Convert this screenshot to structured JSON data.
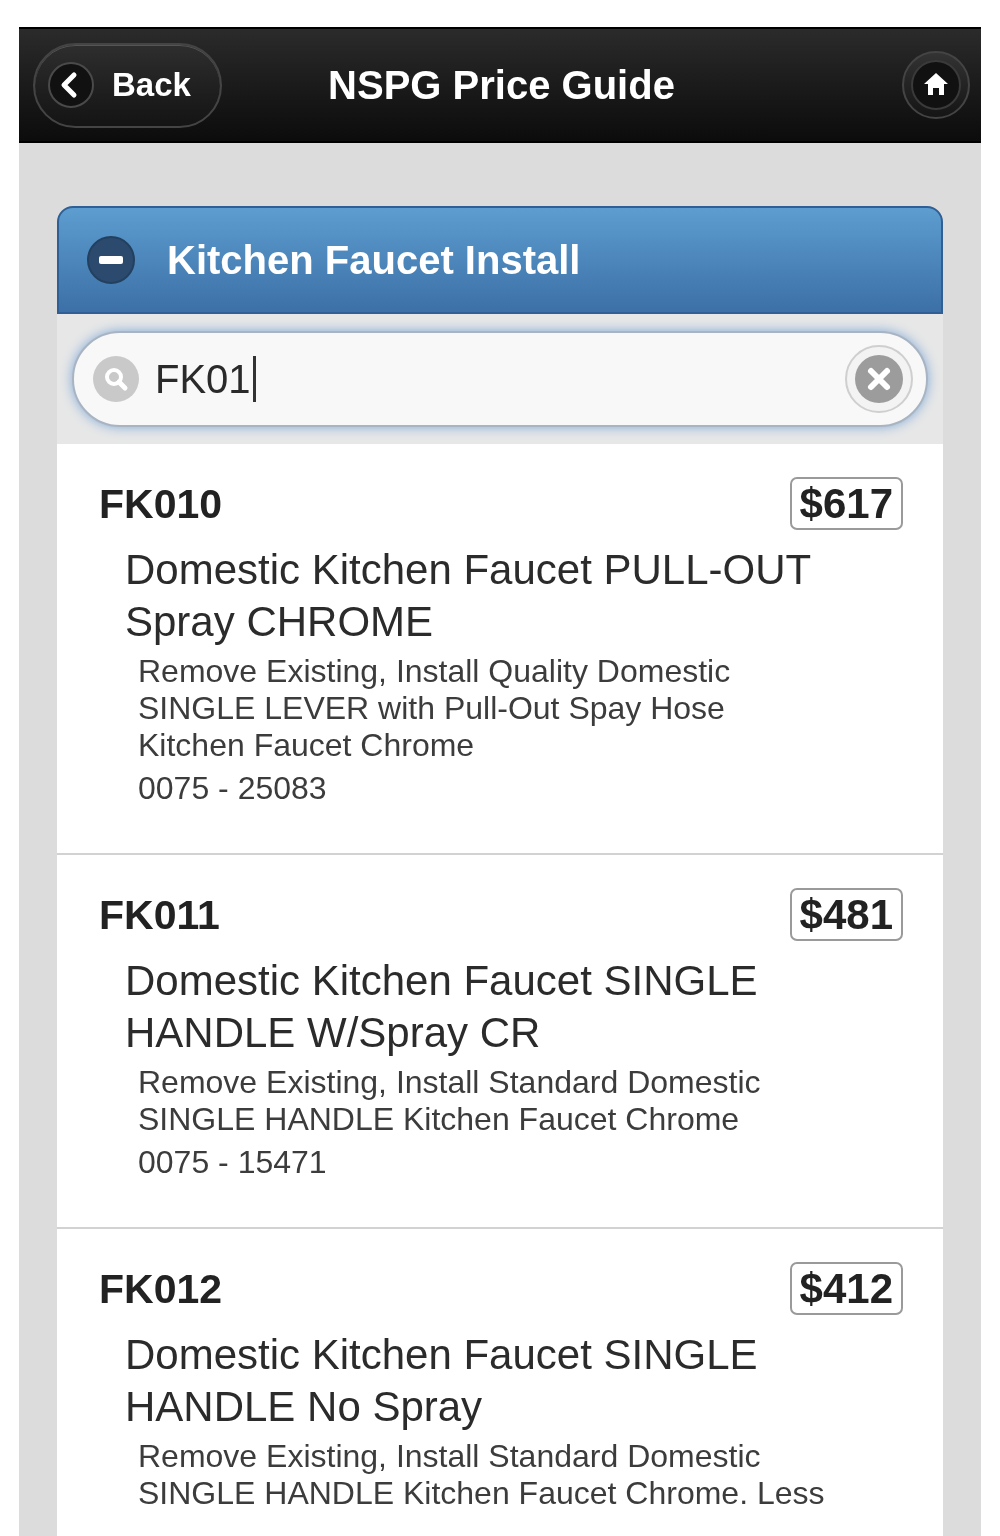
{
  "header": {
    "back_button": "Back",
    "title": "NSPG Price Guide"
  },
  "section": {
    "title": "Kitchen Faucet Install",
    "expanded": true,
    "search": {
      "value": "FK01"
    },
    "items": [
      {
        "code": "FK010",
        "price": "$617",
        "name": "Domestic Kitchen Faucet PULL-OUT Spray CHROME",
        "description": "Remove Existing, Install Quality Domestic SINGLE LEVER with Pull-Out Spay Hose Kitchen Faucet Chrome",
        "part_number": "0075 - 25083"
      },
      {
        "code": "FK011",
        "price": "$481",
        "name": "Domestic Kitchen Faucet SINGLE HANDLE W/Spray CR",
        "description": "Remove Existing, Install Standard Domestic SINGLE HANDLE Kitchen Faucet Chrome",
        "part_number": "0075 - 15471"
      },
      {
        "code": "FK012",
        "price": "$412",
        "name": "Domestic Kitchen Faucet SINGLE HANDLE No Spray",
        "description": "Remove Existing, Install Standard Domestic SINGLE HANDLE Kitchen Faucet Chrome. Less"
      }
    ]
  }
}
